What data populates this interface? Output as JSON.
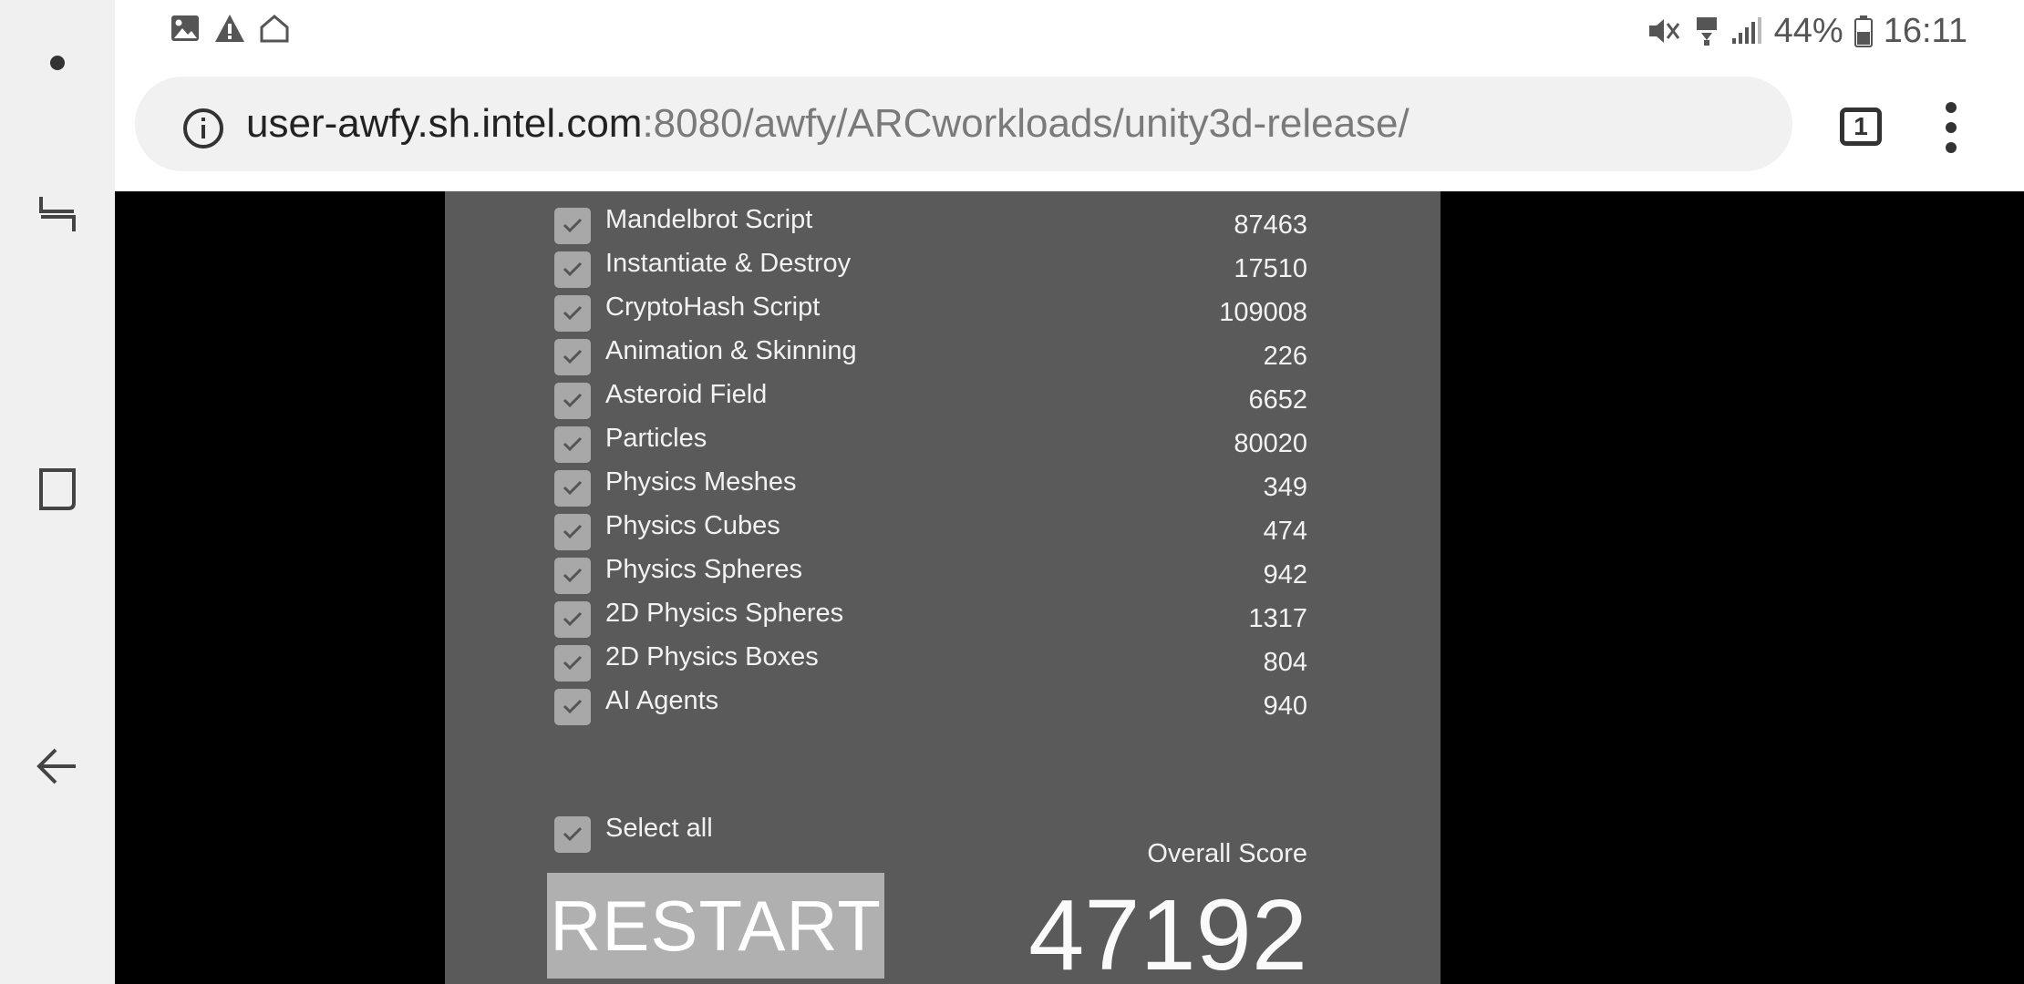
{
  "status_bar": {
    "battery": "44%",
    "time": "16:11",
    "left_icons": [
      "image-icon",
      "warning-icon",
      "home-outline-icon"
    ],
    "right_icons": [
      "mute-vibrate-icon",
      "data-transfer-icon",
      "signal-icon",
      "battery-icon"
    ]
  },
  "browser": {
    "url_host": "user-awfy.sh.intel.com",
    "url_path": ":8080/awfy/ARCworkloads/unity3d-release/",
    "tab_count": "1"
  },
  "benchmark": {
    "tests": [
      {
        "label": "Mandelbrot Script",
        "value": "87463",
        "checked": true
      },
      {
        "label": "Instantiate & Destroy",
        "value": "17510",
        "checked": true
      },
      {
        "label": "CryptoHash Script",
        "value": "109008",
        "checked": true
      },
      {
        "label": "Animation & Skinning",
        "value": "226",
        "checked": true
      },
      {
        "label": "Asteroid Field",
        "value": "6652",
        "checked": true
      },
      {
        "label": "Particles",
        "value": "80020",
        "checked": true
      },
      {
        "label": "Physics Meshes",
        "value": "349",
        "checked": true
      },
      {
        "label": "Physics Cubes",
        "value": "474",
        "checked": true
      },
      {
        "label": "Physics Spheres",
        "value": "942",
        "checked": true
      },
      {
        "label": "2D Physics Spheres",
        "value": "1317",
        "checked": true
      },
      {
        "label": "2D Physics Boxes",
        "value": "804",
        "checked": true
      },
      {
        "label": "AI Agents",
        "value": "940",
        "checked": true
      }
    ],
    "select_all_label": "Select all",
    "select_all_checked": true,
    "overall_score_label": "Overall Score",
    "overall_score": "47192",
    "restart_label": "RESTART"
  },
  "colors": {
    "panel": "#5a5a5a",
    "checkbox": "#a8a8a8",
    "restart_button": "#b0b0b0"
  }
}
